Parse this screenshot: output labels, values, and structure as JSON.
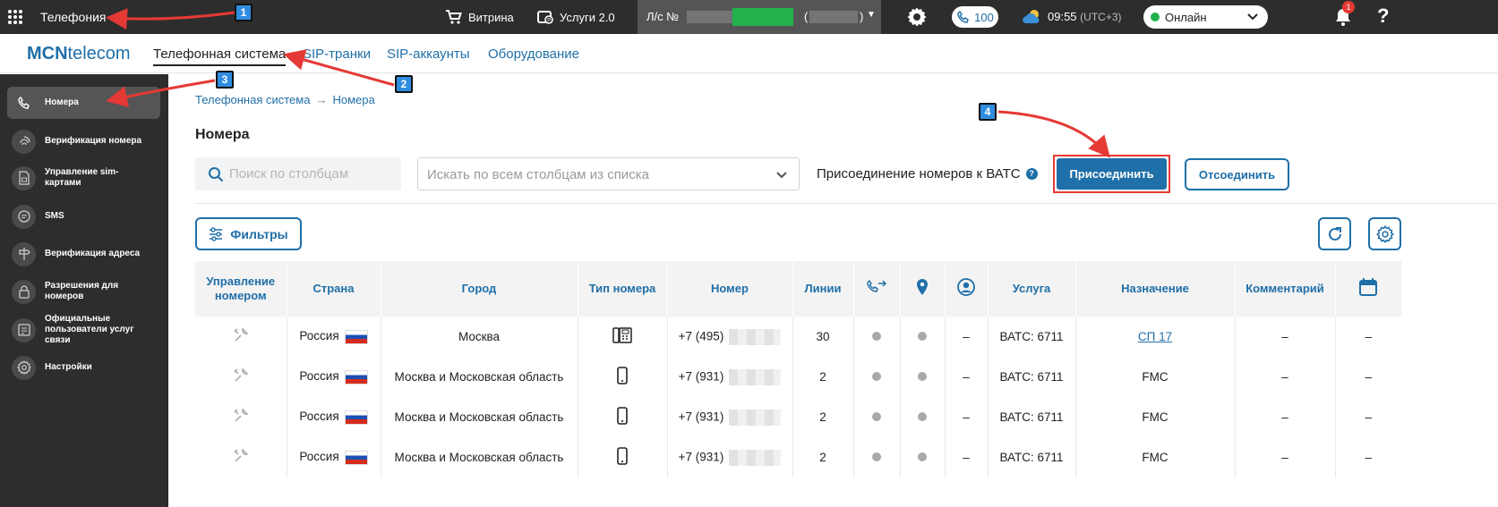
{
  "topbar": {
    "app_title": "Телефония",
    "shop": "Витрина",
    "services": "Услуги 2.0",
    "account_label": "Л/с №",
    "account_paren_open": "(",
    "account_paren_close": ")",
    "calls_count": "100",
    "time": "09:55",
    "timezone": "(UTC+3)",
    "status": "Онлайн",
    "notif_count": "1",
    "help": "?"
  },
  "nav": {
    "logo_bold": "MCN",
    "logo_rest": "telecom",
    "tabs": [
      "Телефонная система",
      "SIP-транки",
      "SIP-аккаунты",
      "Оборудование"
    ]
  },
  "sidebar": {
    "items": [
      {
        "label": "Номера",
        "icon": "phone-icon"
      },
      {
        "label": "Верификация номера",
        "icon": "fingerprint-icon"
      },
      {
        "label": "Управление sim-картами",
        "icon": "sim-icon"
      },
      {
        "label": "SMS",
        "icon": "sms-icon"
      },
      {
        "label": "Верификация адреса",
        "icon": "signpost-icon"
      },
      {
        "label": "Разрешения для номеров",
        "icon": "lock-icon"
      },
      {
        "label": "Официальные пользователи услуг связи",
        "icon": "id-card-icon"
      },
      {
        "label": "Настройки",
        "icon": "gear-icon"
      }
    ]
  },
  "breadcrumb": {
    "root": "Телефонная система",
    "sep": "→",
    "current": "Номера"
  },
  "page_title": "Номера",
  "search": {
    "placeholder": "Поиск по столбцам"
  },
  "column_select": {
    "placeholder": "Искать по всем столбцам из списка"
  },
  "vats": {
    "label": "Присоединение номеров к ВАТС",
    "help": "?",
    "join": "Присоединить",
    "detach": "Отсоединить"
  },
  "filters_button": "Фильтры",
  "table": {
    "headers": {
      "manage": "Управление номером",
      "country": "Страна",
      "city": "Город",
      "type": "Тип номера",
      "number": "Номер",
      "lines": "Линии",
      "service": "Услуга",
      "purpose": "Назначение",
      "comment": "Комментарий"
    },
    "rows": [
      {
        "country": "Россия",
        "city": "Москва",
        "type": "desk-phone",
        "prefix": "+7 (495)",
        "lines": "30",
        "forward": "–",
        "service": "ВАТС: 6711",
        "purpose": "СП 17",
        "comment": "–",
        "date": "–"
      },
      {
        "country": "Россия",
        "city": "Москва и Московская область",
        "type": "mobile",
        "prefix": "+7 (931)",
        "lines": "2",
        "forward": "–",
        "service": "ВАТС: 6711",
        "purpose": "FMC",
        "comment": "–",
        "date": "–"
      },
      {
        "country": "Россия",
        "city": "Москва и Московская область",
        "type": "mobile",
        "prefix": "+7 (931)",
        "lines": "2",
        "forward": "–",
        "service": "ВАТС: 6711",
        "purpose": "FMC",
        "comment": "–",
        "date": "–"
      },
      {
        "country": "Россия",
        "city": "Москва и Московская область",
        "type": "mobile",
        "prefix": "+7 (931)",
        "lines": "2",
        "forward": "–",
        "service": "ВАТС: 6711",
        "purpose": "FMC",
        "comment": "–",
        "date": "–"
      }
    ]
  },
  "annotations": [
    "1",
    "2",
    "3",
    "4"
  ],
  "colors": {
    "accent": "#1f6fa8",
    "dark": "#2d2d2d",
    "highlight": "#e53935",
    "online": "#22b14c",
    "marker": "#2f8de0"
  }
}
